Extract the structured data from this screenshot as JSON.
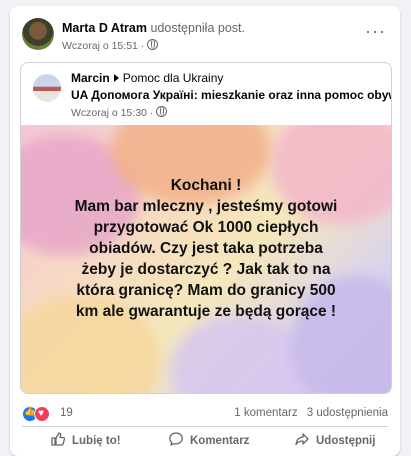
{
  "post": {
    "author": "Marta D Atram",
    "action": "udostępniła post.",
    "time": "Wczoraj o 15:51 ·"
  },
  "shared": {
    "author": "Marcin",
    "group_part1": "Pomoc dla Ukrainy",
    "group_part2": "UA Допомога Україні: mieszkanie oraz inna pomoc obywatel",
    "time": "Wczoraj o 15:30 ·"
  },
  "image_text": [
    "Kochani !",
    "Mam bar mleczny , jesteśmy gotowi",
    "przygotować Ok 1000 ciepłych",
    "obiadów. Czy jest taka potrzeba",
    "żeby je dostarczyć ? Jak tak to na",
    "która granicę? Mam do granicy 500",
    "km ale gwarantuje ze będą gorące !"
  ],
  "reactions": {
    "count": "19",
    "comments": "1 komentarz",
    "shares": "3 udostępnienia"
  },
  "actions": {
    "like": "Lubię to!",
    "comment": "Komentarz",
    "share": "Udostępnij"
  },
  "colors": {
    "like": "#1877f2",
    "love": "#f33e58"
  }
}
